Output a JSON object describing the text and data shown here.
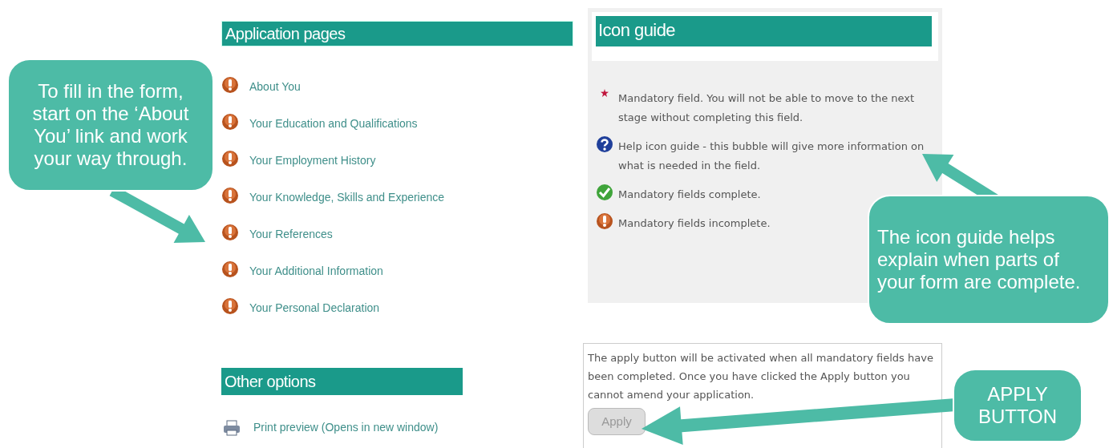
{
  "application_pages": {
    "title": "Application pages",
    "items": [
      {
        "label": "About You",
        "complete": false
      },
      {
        "label": "Your Education and Qualifications",
        "complete": false
      },
      {
        "label": "Your Employment History",
        "complete": false
      },
      {
        "label": "Your Knowledge, Skills and Experience",
        "complete": false
      },
      {
        "label": "Your References",
        "complete": false
      },
      {
        "label": "Your Additional Information",
        "complete": false
      },
      {
        "label": "Your Personal Declaration",
        "complete": false
      }
    ]
  },
  "other_options": {
    "title": "Other options",
    "items": [
      {
        "label": "Print preview (Opens in new window)"
      }
    ]
  },
  "icon_guide": {
    "title": "Icon guide",
    "entries": [
      {
        "kind": "mandatory",
        "text": "Mandatory field. You will not be able to move to the next stage without completing this field."
      },
      {
        "kind": "help",
        "text": "Help icon guide - this bubble will give more information on what is needed in the field."
      },
      {
        "kind": "complete",
        "text": "Mandatory fields complete."
      },
      {
        "kind": "incomplete",
        "text": "Mandatory fields incomplete."
      }
    ]
  },
  "apply_panel": {
    "text": "The apply button will be activated when all mandatory fields have been completed. Once you have clicked the Apply button you cannot amend your application.",
    "button": {
      "label": "Apply",
      "disabled": true
    }
  },
  "callouts": [
    {
      "kind": "left",
      "text": "To fill in the form, start on the ‘About You’ link and work your way through."
    },
    {
      "kind": "guide",
      "text": "The icon guide helps explain when parts of your form are complete."
    },
    {
      "kind": "apply",
      "text": "APPLY BUTTON"
    }
  ]
}
